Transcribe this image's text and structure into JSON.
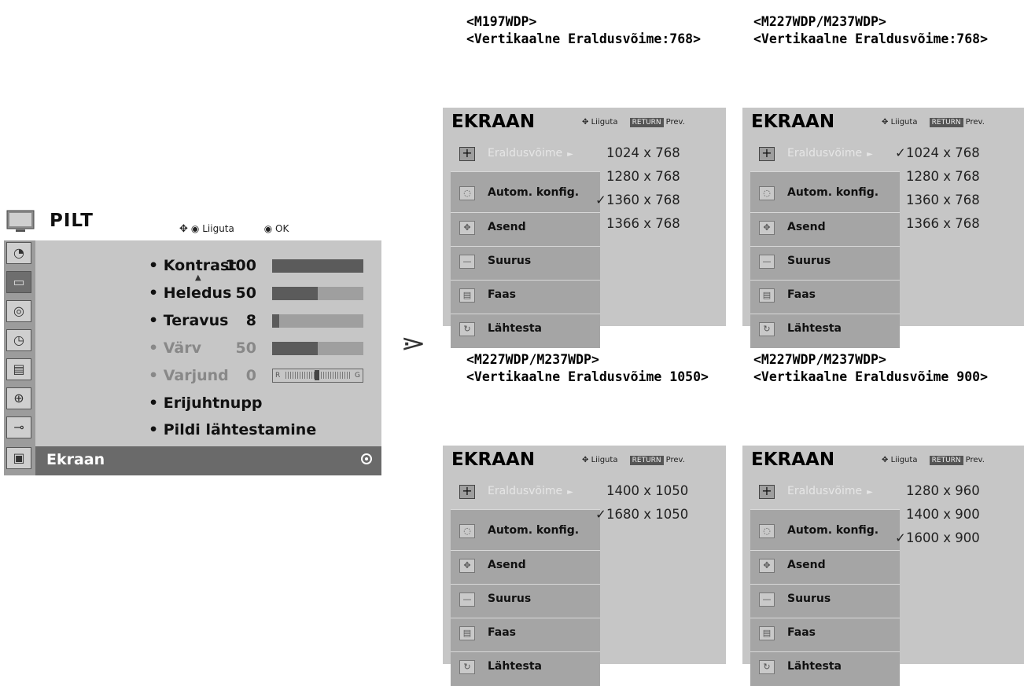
{
  "pilt_menu": {
    "title": "PILT",
    "hint_move": "Liiguta",
    "hint_ok": "OK",
    "rows": [
      {
        "label": "• Kontrast",
        "value": "100",
        "level": 100
      },
      {
        "label": "• Heledus",
        "value": "50",
        "level": 50
      },
      {
        "label": "• Teravus",
        "value": "8",
        "level": 8
      },
      {
        "label": "• Värv",
        "value": "50",
        "level": 50
      },
      {
        "label": "• Varjund",
        "value": "0",
        "tint_left": "R",
        "tint_right": "G"
      },
      {
        "label": "• Erijuhtnupp"
      },
      {
        "label": "• Pildi lähtestamine"
      }
    ],
    "selected": "Ekraan",
    "left_icons": [
      "satellite-dish-icon",
      "tv-picture-icon",
      "speaker-icon",
      "clock-icon",
      "option-icon",
      "lock-icon",
      "input-plug-icon",
      "screen-icon"
    ]
  },
  "transition_symbol": "⋗",
  "panels": [
    {
      "caption_line1": "<M197WDP>",
      "caption_line2": "<Vertikaalne Eraldusvõime:768>",
      "title": "EKRAAN",
      "hint_move": "Liiguta",
      "hint_return": "RETURN",
      "hint_prev": "Prev.",
      "items": [
        "Eraldusvõime",
        "Autom. konfig.",
        "Asend",
        "Suurus",
        "Faas",
        "Lähtesta"
      ],
      "options": [
        "1024 x 768",
        "1280 x 768",
        "1360 x 768",
        "1366 x 768"
      ],
      "checked": [
        "",
        "",
        "✓",
        ""
      ]
    },
    {
      "caption_line1": "<M227WDP/M237WDP>",
      "caption_line2": "<Vertikaalne Eraldusvõime:768>",
      "title": "EKRAAN",
      "hint_move": "Liiguta",
      "hint_return": "RETURN",
      "hint_prev": "Prev.",
      "items": [
        "Eraldusvõime",
        "Autom. konfig.",
        "Asend",
        "Suurus",
        "Faas",
        "Lähtesta"
      ],
      "options": [
        "1024 x 768",
        "1280 x 768",
        "1360 x 768",
        "1366 x 768"
      ],
      "checked": [
        "✓",
        "",
        "",
        ""
      ]
    },
    {
      "caption_line1": "<M227WDP/M237WDP>",
      "caption_line2": "<Vertikaalne Eraldusvõime 1050>",
      "title": "EKRAAN",
      "hint_move": "Liiguta",
      "hint_return": "RETURN",
      "hint_prev": "Prev.",
      "items": [
        "Eraldusvõime",
        "Autom. konfig.",
        "Asend",
        "Suurus",
        "Faas",
        "Lähtesta"
      ],
      "options": [
        "1400 x 1050",
        "1680 x 1050"
      ],
      "checked": [
        "",
        "✓"
      ]
    },
    {
      "caption_line1": "<M227WDP/M237WDP>",
      "caption_line2": "<Vertikaalne Eraldusvõime 900>",
      "title": "EKRAAN",
      "hint_move": "Liiguta",
      "hint_return": "RETURN",
      "hint_prev": "Prev.",
      "items": [
        "Eraldusvõime",
        "Autom. konfig.",
        "Asend",
        "Suurus",
        "Faas",
        "Lähtesta"
      ],
      "options": [
        "1280 x 960",
        "1400 x 900",
        "1600 x 900"
      ],
      "checked": [
        "",
        "",
        "✓"
      ]
    }
  ],
  "colors": {
    "panel_bg": "#c6c6c6",
    "submenu_bg": "#a5a5a5",
    "selected_bar": "#6a6a6a",
    "bar_fill": "#5b5b5b"
  }
}
